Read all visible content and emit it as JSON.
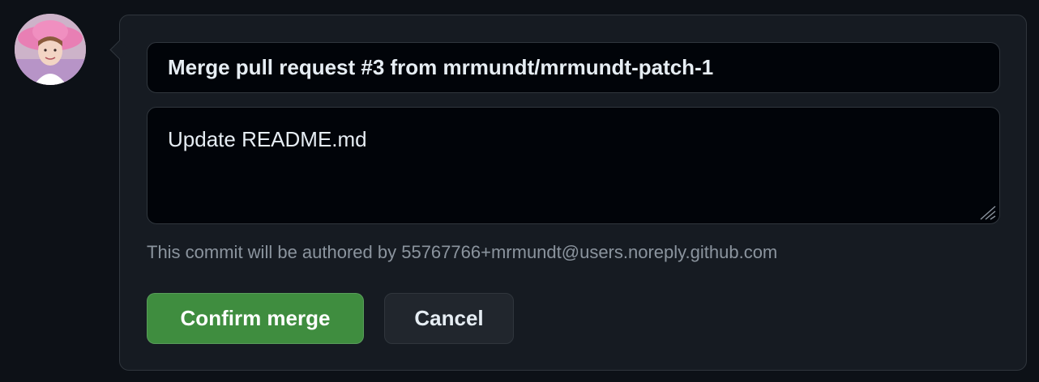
{
  "merge_form": {
    "title_value": "Merge pull request #3 from mrmundt/mrmundt-patch-1",
    "message_value": "Update README.md",
    "author_note": "This commit will be authored by 55767766+mrmundt@users.noreply.github.com",
    "confirm_label": "Confirm merge",
    "cancel_label": "Cancel"
  },
  "avatar": {
    "icon": "user-avatar"
  },
  "colors": {
    "page_background": "#0d1117",
    "panel_background": "#161b22",
    "input_background": "#010409",
    "border": "#30363d",
    "confirm_button": "#3f8d3f",
    "cancel_button": "#21262d",
    "muted_text": "#8b949e",
    "primary_text": "#e6edf3"
  }
}
